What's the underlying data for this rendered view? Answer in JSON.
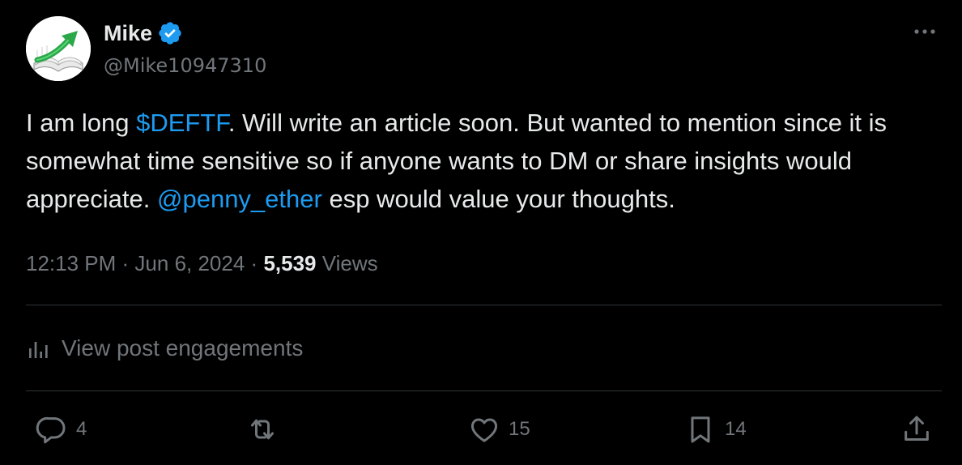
{
  "author": {
    "name": "Mike",
    "handle": "@Mike10947310",
    "verified": true
  },
  "post": {
    "segments": [
      {
        "text": "I am long ",
        "type": "text"
      },
      {
        "text": "$DEFTF",
        "type": "link"
      },
      {
        "text": ". Will write an article soon. But wanted to mention since it is somewhat time sensitive so if anyone wants to DM or share insights would appreciate. ",
        "type": "text"
      },
      {
        "text": "@penny_ether",
        "type": "link"
      },
      {
        "text": " esp would value your thoughts.",
        "type": "text"
      }
    ]
  },
  "meta": {
    "time": "12:13 PM",
    "date": "Jun 6, 2024",
    "views_count": "5,539",
    "views_label": "Views"
  },
  "engagements_label": "View post engagements",
  "actions": {
    "replies": "4",
    "reposts": "",
    "likes": "15",
    "bookmarks": "14"
  },
  "colors": {
    "background": "#000000",
    "text": "#e7e9ea",
    "secondary": "#71767b",
    "accent": "#1d9bf0",
    "divider": "#2f3336"
  },
  "icons": {
    "avatar": "book-with-rising-arrow",
    "verified": "verified-badge-icon",
    "more": "more-options-icon",
    "engagements": "analytics-bars-icon",
    "reply": "reply-icon",
    "repost": "repost-icon",
    "like": "heart-icon",
    "bookmark": "bookmark-icon",
    "share": "share-icon"
  }
}
